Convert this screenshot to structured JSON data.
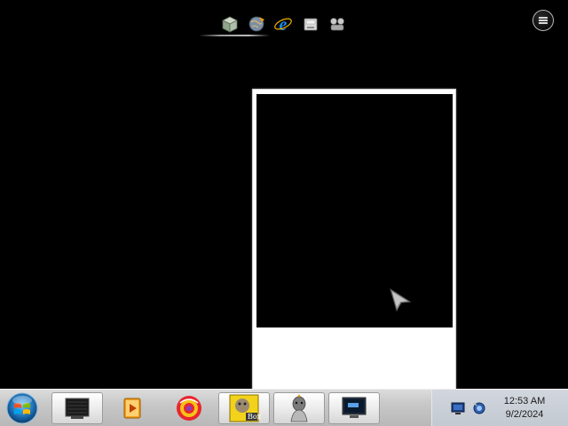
{
  "top_launch": {
    "icons": [
      "box-icon",
      "web-globe-icon",
      "internet-explorer-icon",
      "drive-icon",
      "network-icon"
    ]
  },
  "corner_button": {
    "icon": "menu-lines-icon"
  },
  "window": {
    "content_color": "#000000",
    "frame_color": "#ffffff"
  },
  "taskbar": {
    "start_icon": "windows-logo-icon",
    "buttons": [
      {
        "icon": "terminal-icon",
        "active": true
      },
      {
        "icon": "media-player-icon",
        "active": false
      },
      {
        "icon": "browser-icon",
        "active": false
      },
      {
        "icon": "box-app-icon",
        "active": true,
        "label": "Box"
      },
      {
        "icon": "character-icon",
        "active": true
      },
      {
        "icon": "monitor-icon",
        "active": true
      }
    ],
    "tray": {
      "icons": [
        "display-tray-icon",
        "network-tray-icon"
      ],
      "time": "12:53 AM",
      "date": "9/2/2024"
    }
  },
  "colors": {
    "desktop": "#000000",
    "taskbar": "#c8c8c8",
    "ie_blue": "#1e88e5"
  }
}
